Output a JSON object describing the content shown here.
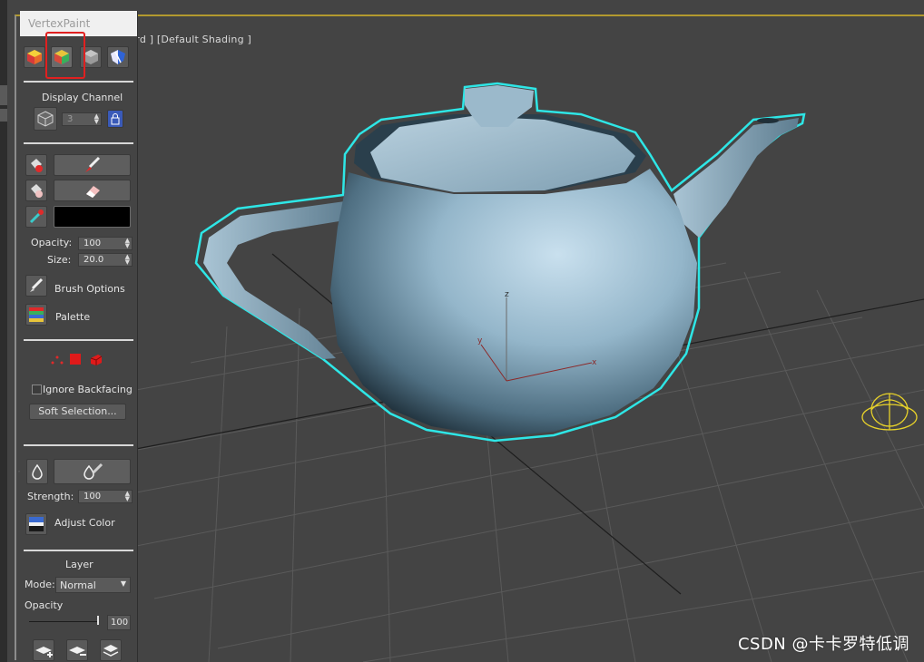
{
  "viewport": {
    "label_left": "[",
    "label_right": "rd ] [Default Shading ]",
    "axis_labels": {
      "z": "z",
      "y": "y",
      "x": "x"
    }
  },
  "panel": {
    "title": "VertexPaint",
    "display_channel": {
      "heading": "Display Channel",
      "value": "3"
    },
    "opacity": {
      "label": "Opacity:",
      "value": "100"
    },
    "size": {
      "label": "Size:",
      "value": "20.0"
    },
    "brush_options": "Brush Options",
    "palette": "Palette",
    "ignore_backfacing": "Ignore Backfacing",
    "soft_selection": "Soft Selection...",
    "strength": {
      "label": "Strength:",
      "value": "100"
    },
    "adjust_color": "Adjust Color",
    "layer": {
      "heading": "Layer",
      "mode_label": "Mode:",
      "mode_value": "Normal",
      "opacity_label": "Opacity",
      "opacity_value": "100"
    },
    "paint_color": "#000000"
  },
  "watermark": "CSDN @卡卡罗特低调",
  "colors": {
    "selection_outline": "#2ee6e6",
    "highlight_frame": "#e02020",
    "helper_yellow": "#e8d22a",
    "teapot_base": "#8fb3c9"
  }
}
